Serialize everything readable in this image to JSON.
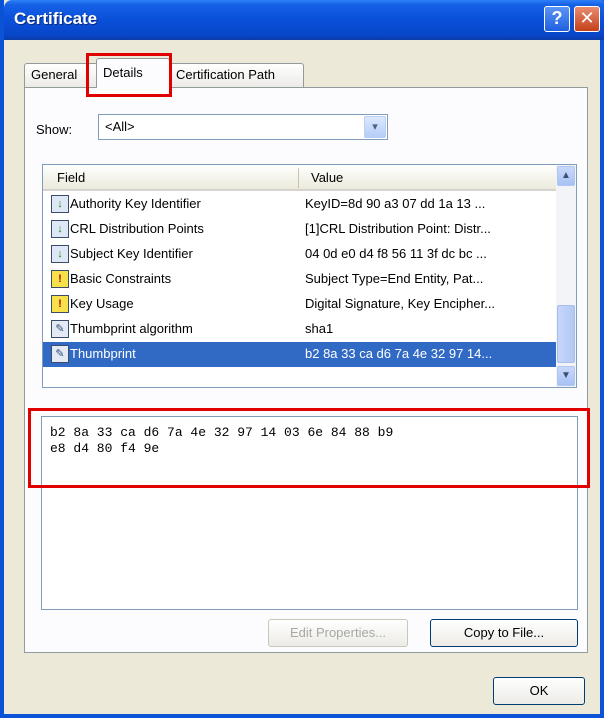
{
  "window": {
    "title": "Certificate",
    "help_glyph": "?",
    "close_glyph": "✕"
  },
  "tabs": [
    {
      "label": "General"
    },
    {
      "label": "Details"
    },
    {
      "label": "Certification Path"
    }
  ],
  "show": {
    "label": "Show:",
    "value": "<All>",
    "dropdown_glyph": "▾"
  },
  "list": {
    "columns": [
      "Field",
      "Value"
    ],
    "rows": [
      {
        "field": "Authority Key Identifier",
        "value": "KeyID=8d 90 a3 07 dd 1a 13 ...",
        "icon": "extension-icon"
      },
      {
        "field": "CRL Distribution Points",
        "value": "[1]CRL Distribution Point: Distr...",
        "icon": "extension-icon"
      },
      {
        "field": "Subject Key Identifier",
        "value": "04 0d e0 d4 f8 56 11 3f dc bc ...",
        "icon": "extension-icon"
      },
      {
        "field": "Basic Constraints",
        "value": "Subject Type=End Entity, Pat...",
        "icon": "critical-extension-icon"
      },
      {
        "field": "Key Usage",
        "value": "Digital Signature, Key Encipher...",
        "icon": "critical-extension-icon"
      },
      {
        "field": "Thumbprint algorithm",
        "value": "sha1",
        "icon": "property-icon"
      },
      {
        "field": "Thumbprint",
        "value": "b2 8a 33 ca d6 7a 4e 32 97 14...",
        "icon": "property-icon",
        "selected": true
      }
    ],
    "scroll_up_glyph": "▲",
    "scroll_down_glyph": "▼"
  },
  "detail": {
    "text": "b2 8a 33 ca d6 7a 4e 32 97 14 03 6e 84 88 b9\ne8 d4 80 f4 9e"
  },
  "buttons": {
    "edit_properties": "Edit Properties...",
    "copy_to_file": "Copy to File...",
    "ok": "OK"
  },
  "colors": {
    "titlebar": "#0a4fd9",
    "selection": "#316ac5",
    "highlight_box": "#e00000"
  }
}
